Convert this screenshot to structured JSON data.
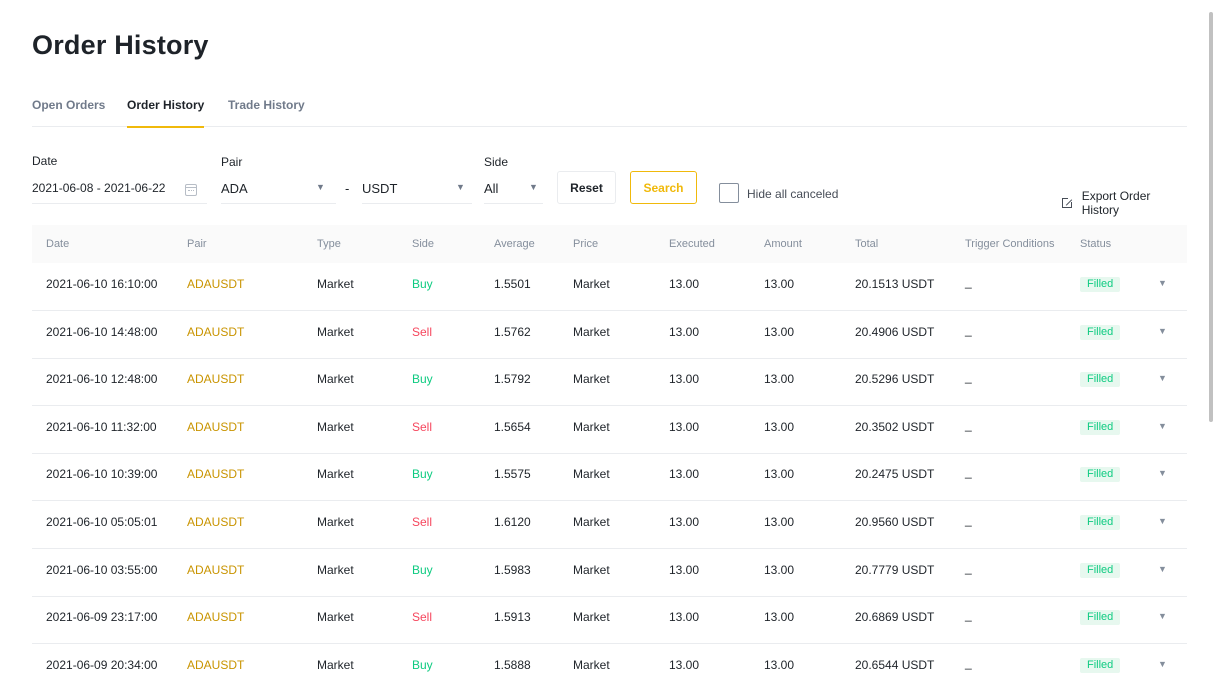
{
  "page": {
    "title": "Order History"
  },
  "tabs": [
    "Open Orders",
    "Order History",
    "Trade History"
  ],
  "filters": {
    "date_label": "Date",
    "date_value": "2021-06-08 - 2021-06-22",
    "pair_label": "Pair",
    "pair_base": "ADA",
    "pair_separator": "-",
    "pair_quote": "USDT",
    "side_label": "Side",
    "side_value": "All",
    "reset_label": "Reset",
    "search_label": "Search",
    "hide_canceled_label": "Hide all canceled",
    "export_label": "Export Order History"
  },
  "table": {
    "columns": [
      "Date",
      "Pair",
      "Type",
      "Side",
      "Average",
      "Price",
      "Executed",
      "Amount",
      "Total",
      "Trigger Conditions",
      "Status"
    ],
    "rows": [
      {
        "date": "2021-06-10 16:10:00",
        "pair": "ADAUSDT",
        "type": "Market",
        "side": "Buy",
        "average": "1.5501",
        "price": "Market",
        "executed": "13.00",
        "amount": "13.00",
        "total": "20.1513 USDT",
        "trigger": "_",
        "status": "Filled"
      },
      {
        "date": "2021-06-10 14:48:00",
        "pair": "ADAUSDT",
        "type": "Market",
        "side": "Sell",
        "average": "1.5762",
        "price": "Market",
        "executed": "13.00",
        "amount": "13.00",
        "total": "20.4906 USDT",
        "trigger": "_",
        "status": "Filled"
      },
      {
        "date": "2021-06-10 12:48:00",
        "pair": "ADAUSDT",
        "type": "Market",
        "side": "Buy",
        "average": "1.5792",
        "price": "Market",
        "executed": "13.00",
        "amount": "13.00",
        "total": "20.5296 USDT",
        "trigger": "_",
        "status": "Filled"
      },
      {
        "date": "2021-06-10 11:32:00",
        "pair": "ADAUSDT",
        "type": "Market",
        "side": "Sell",
        "average": "1.5654",
        "price": "Market",
        "executed": "13.00",
        "amount": "13.00",
        "total": "20.3502 USDT",
        "trigger": "_",
        "status": "Filled"
      },
      {
        "date": "2021-06-10 10:39:00",
        "pair": "ADAUSDT",
        "type": "Market",
        "side": "Buy",
        "average": "1.5575",
        "price": "Market",
        "executed": "13.00",
        "amount": "13.00",
        "total": "20.2475 USDT",
        "trigger": "_",
        "status": "Filled"
      },
      {
        "date": "2021-06-10 05:05:01",
        "pair": "ADAUSDT",
        "type": "Market",
        "side": "Sell",
        "average": "1.6120",
        "price": "Market",
        "executed": "13.00",
        "amount": "13.00",
        "total": "20.9560 USDT",
        "trigger": "_",
        "status": "Filled"
      },
      {
        "date": "2021-06-10 03:55:00",
        "pair": "ADAUSDT",
        "type": "Market",
        "side": "Buy",
        "average": "1.5983",
        "price": "Market",
        "executed": "13.00",
        "amount": "13.00",
        "total": "20.7779 USDT",
        "trigger": "_",
        "status": "Filled"
      },
      {
        "date": "2021-06-09 23:17:00",
        "pair": "ADAUSDT",
        "type": "Market",
        "side": "Sell",
        "average": "1.5913",
        "price": "Market",
        "executed": "13.00",
        "amount": "13.00",
        "total": "20.6869 USDT",
        "trigger": "_",
        "status": "Filled"
      },
      {
        "date": "2021-06-09 20:34:00",
        "pair": "ADAUSDT",
        "type": "Market",
        "side": "Buy",
        "average": "1.5888",
        "price": "Market",
        "executed": "13.00",
        "amount": "13.00",
        "total": "20.6544 USDT",
        "trigger": "_",
        "status": "Filled"
      }
    ]
  },
  "colors": {
    "accent": "#f0b90b",
    "buy": "#0ecb81",
    "sell": "#f6465d",
    "pair": "#c99400",
    "filled_badge_bg": "#e7f8ef"
  },
  "icons": {
    "date_picker": "calendar-icon",
    "dropdown": "caret-down-icon",
    "export": "external-link-icon",
    "row_expand": "caret-down-icon"
  }
}
